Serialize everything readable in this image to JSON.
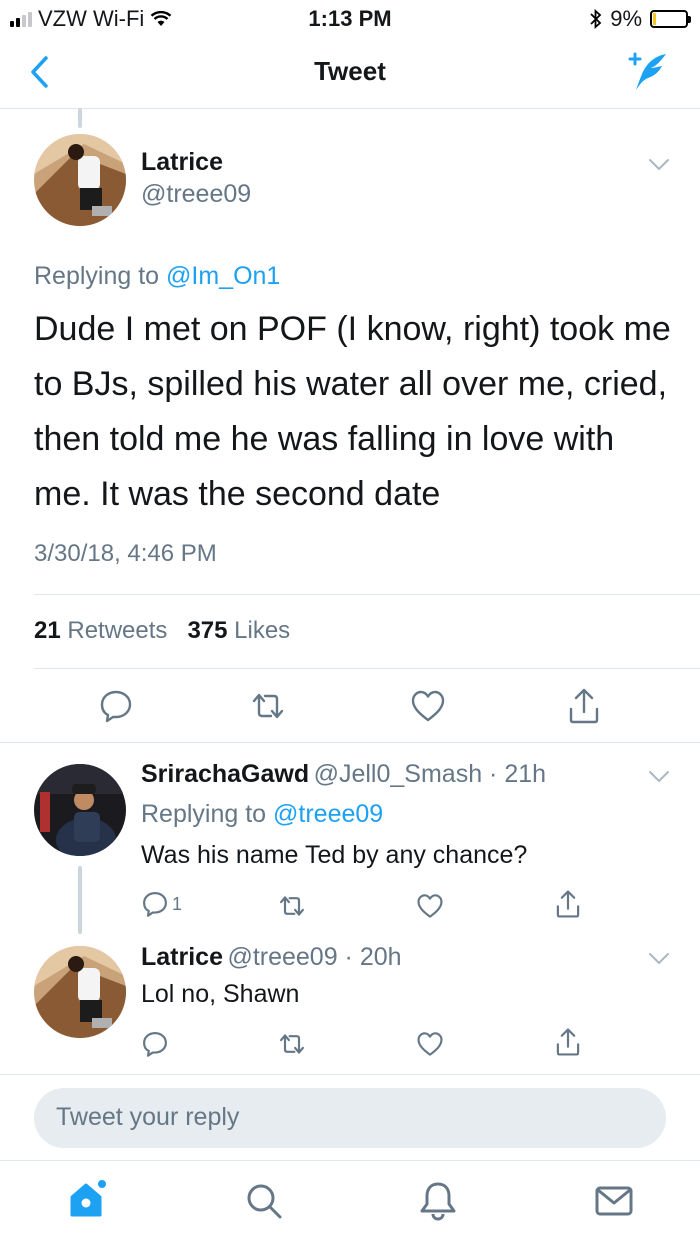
{
  "status_bar": {
    "carrier": "VZW Wi-Fi",
    "time": "1:13 PM",
    "battery": "9%",
    "battery_level": 0.09,
    "bluetooth_icon": "bluetooth-icon",
    "wifi_icon": "wifi-icon"
  },
  "nav": {
    "title": "Tweet",
    "back_icon": "chevron-left-icon",
    "compose_icon": "compose-tweet-icon"
  },
  "main_tweet": {
    "name": "Latrice",
    "handle": "@treee09",
    "replying_prefix": "Replying to",
    "replying_to": "@Im_On1",
    "text": "Dude I met on POF (I know, right) took me to BJs, spilled his water all over me, cried, then told me he was falling in love with me. It was the second date",
    "timestamp": "3/30/18, 4:46 PM",
    "retweets_count": "21",
    "retweets_label": "Retweets",
    "likes_count": "375",
    "likes_label": "Likes"
  },
  "replies": [
    {
      "name": "SrirachaGawd",
      "handle": "@Jell0_Smash",
      "time": "21h",
      "replying_prefix": "Replying to",
      "replying_to": "@treee09",
      "text": "Was his name Ted by any chance?",
      "reply_count": "1"
    },
    {
      "name": "Latrice",
      "handle": "@treee09",
      "time": "20h",
      "text": "Lol no, Shawn"
    }
  ],
  "compose": {
    "placeholder": "Tweet your reply"
  },
  "colors": {
    "accent": "#1da1f2",
    "muted": "#657786",
    "text": "#14171a",
    "divider": "#e1e8ed"
  }
}
